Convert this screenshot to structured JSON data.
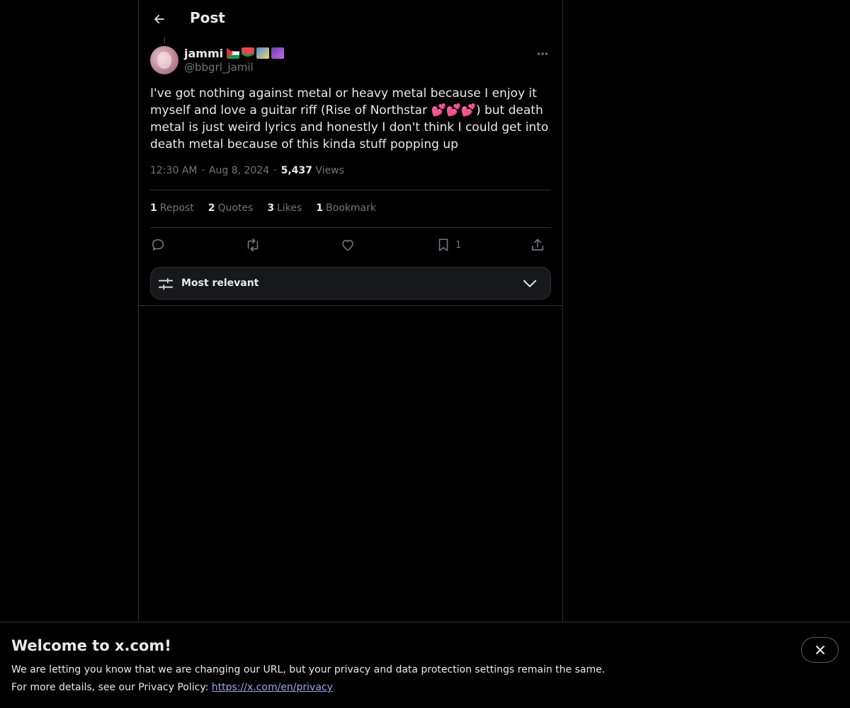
{
  "header": {
    "title": "Post"
  },
  "post": {
    "author": {
      "display_name": "jammi",
      "badges": [
        "palestine-flag",
        "watermelon",
        "rocket",
        "galaxy"
      ],
      "handle": "@bbgrl_jamil"
    },
    "text": "I've got nothing against metal or heavy metal because I enjoy it myself and love a guitar riff (Rise of Northstar 💕💕💕) but death metal is just weird lyrics and honestly I don't think I could get into death metal because of this kinda stuff popping up",
    "time": "12:30 AM",
    "separator": "·",
    "date": "Aug 8, 2024",
    "views_count": "5,437",
    "views_label": "Views",
    "stats": [
      {
        "num": "1",
        "label": "Repost"
      },
      {
        "num": "2",
        "label": "Quotes"
      },
      {
        "num": "3",
        "label": "Likes"
      },
      {
        "num": "1",
        "label": "Bookmark"
      }
    ],
    "actions": {
      "reply_icon": "reply-icon",
      "repost_icon": "repost-icon",
      "like_icon": "heart-icon",
      "bookmark_icon": "bookmark-icon",
      "bookmark_count": "1",
      "share_icon": "share-icon"
    }
  },
  "replies_sort": {
    "label": "Most relevant"
  },
  "banner": {
    "title": "Welcome to x.com!",
    "line1": "We are letting you know that we are changing our URL, but your privacy and data protection settings remain the same.",
    "line2_prefix": "For more details, see our Privacy Policy: ",
    "link": "https://x.com/en/privacy"
  },
  "colors": {
    "background": "#000000",
    "text": "#e7e9ea",
    "muted": "#71767b",
    "border": "#2f3336",
    "link": "#9da6e8"
  }
}
